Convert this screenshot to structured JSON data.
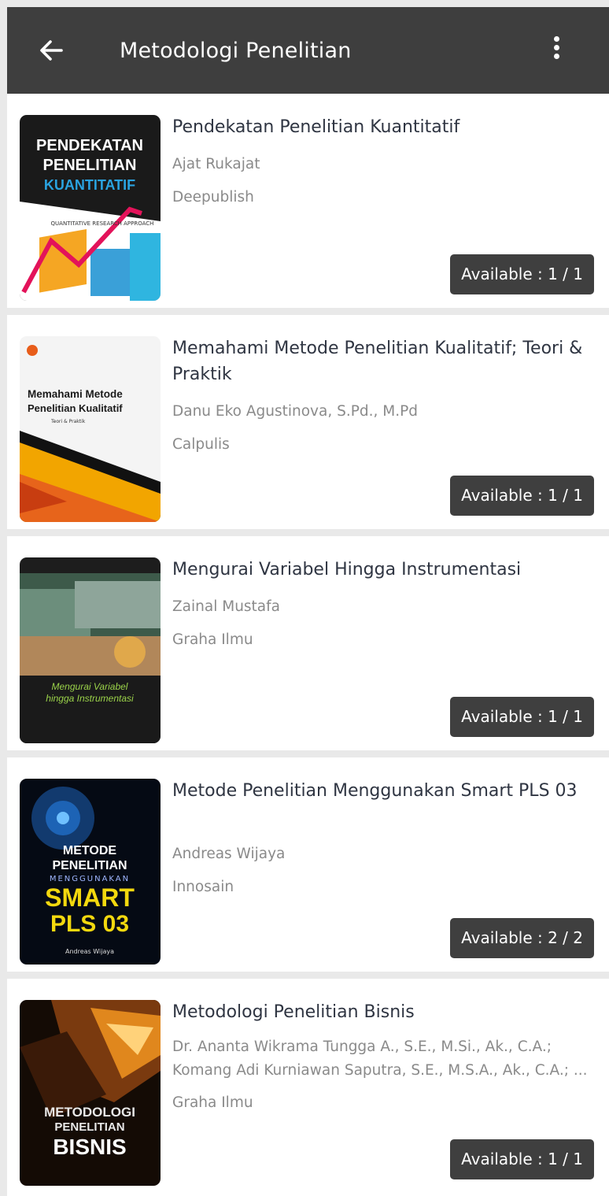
{
  "app_bar": {
    "title": "Metodologi Penelitian",
    "back_icon": "arrow-left-icon",
    "menu_icon": "more-vert-icon"
  },
  "books": [
    {
      "title": "Pendekatan Penelitian Kuantitatif",
      "author": "Ajat Rukajat",
      "publisher": "Deepublish",
      "availability": "Available : 1 / 1",
      "cover": {
        "line1": "PENDEKATAN",
        "line2": "PENELITIAN",
        "line3": "KUANTITATIF",
        "small": "QUANTITATIVE RESEARCH APPROACH"
      }
    },
    {
      "title": "Memahami Metode Penelitian Kualitatif; Teori & Praktik",
      "author": "Danu Eko Agustinova, S.Pd., M.Pd",
      "publisher": "Calpulis",
      "availability": "Available : 1 / 1",
      "cover": {
        "line1": "Memahami Metode",
        "line2": "Penelitian Kualitatif",
        "small": "Teori & Praktik"
      }
    },
    {
      "title": "Mengurai Variabel Hingga Instrumentasi",
      "author": "Zainal Mustafa",
      "publisher": "Graha Ilmu",
      "availability": "Available : 1 / 1",
      "cover": {
        "line1": "Mengurai Variabel",
        "line2": "hingga Instrumentasi"
      }
    },
    {
      "title": "Metode Penelitian Menggunakan Smart PLS 03",
      "author": "Andreas Wijaya",
      "publisher": "Innosain",
      "availability": "Available : 2 / 2",
      "cover": {
        "line1": "METODE",
        "line2": "PENELITIAN",
        "line3": "MENGGUNAKAN",
        "line4": "SMART",
        "line5": "PLS 03",
        "small": "Andreas Wijaya"
      }
    },
    {
      "title": "Metodologi Penelitian Bisnis",
      "author": "Dr. Ananta Wikrama Tungga A., S.E., M.Si., Ak., C.A.; Komang Adi Kurniawan Saputra, S.E., M.S.A., Ak., C.A.; ...",
      "publisher": "Graha Ilmu",
      "availability": "Available : 1 / 1",
      "cover": {
        "line1": "METODOLOGI",
        "line2": "PENELITIAN",
        "line3": "BISNIS"
      }
    }
  ]
}
